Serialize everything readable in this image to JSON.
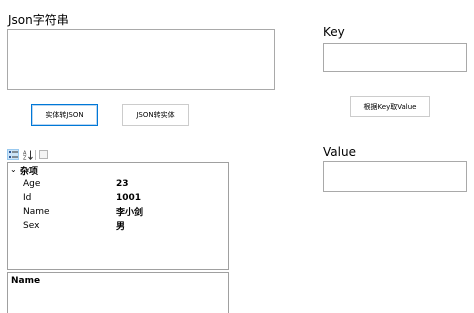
{
  "json_section": {
    "label": "Json字符串",
    "value": ""
  },
  "key_section": {
    "label": "Key",
    "value": ""
  },
  "value_section": {
    "label": "Value",
    "value": ""
  },
  "buttons": {
    "entity_to_json": "实体转JSON",
    "json_to_entity": "JSON转实体",
    "get_value_by_key": "根据Key取Value"
  },
  "property_grid": {
    "category": "杂项",
    "properties": [
      {
        "name": "Age",
        "value": "23"
      },
      {
        "name": "Id",
        "value": "1001"
      },
      {
        "name": "Name",
        "value": "李小剑"
      },
      {
        "name": "Sex",
        "value": "男"
      }
    ],
    "description_title": "Name"
  },
  "colors": {
    "accent": "#0078d7",
    "border": "#a9a9a9"
  }
}
